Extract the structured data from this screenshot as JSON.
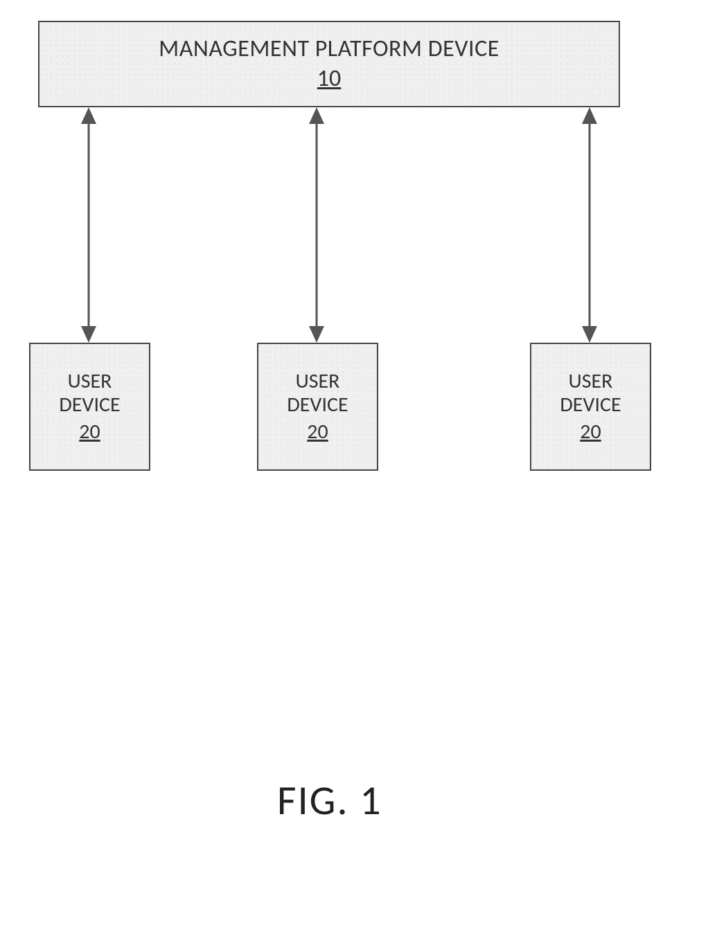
{
  "top_box": {
    "title": "MANAGEMENT PLATFORM DEVICE",
    "ref": "10"
  },
  "user_boxes": [
    {
      "title_line1": "USER",
      "title_line2": "DEVICE",
      "ref": "20"
    },
    {
      "title_line1": "USER",
      "title_line2": "DEVICE",
      "ref": "20"
    },
    {
      "title_line1": "USER",
      "title_line2": "DEVICE",
      "ref": "20"
    }
  ],
  "figure_label": "FIG. 1"
}
